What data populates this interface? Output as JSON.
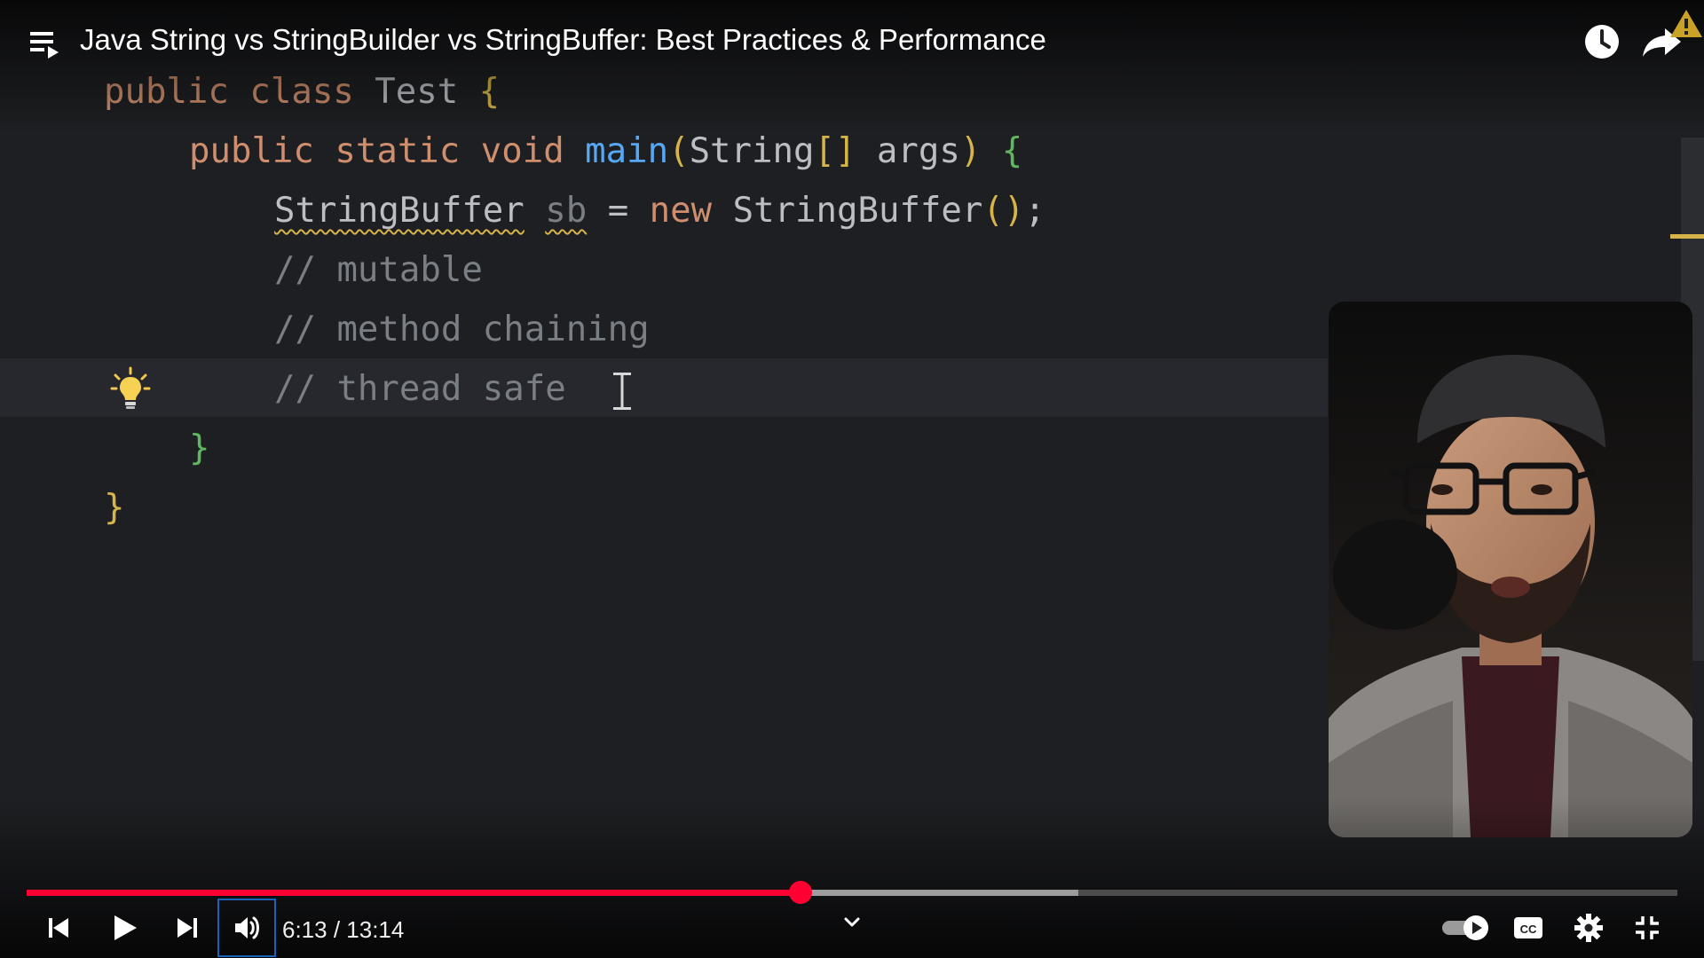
{
  "header": {
    "title": "Java String vs StringBuilder vs StringBuffer: Best Practices & Performance",
    "icons": [
      "playlist-icon",
      "watch-later-icon",
      "share-icon",
      "warning-icon"
    ]
  },
  "editor": {
    "lines": [
      {
        "tokens": [
          "public",
          "class",
          "Test",
          "{"
        ]
      },
      {
        "tokens": [
          "public",
          "static",
          "void",
          "main",
          "(",
          "String",
          "[]",
          "args",
          ")",
          "{"
        ]
      },
      {
        "tokens": [
          "StringBuffer",
          "sb",
          "=",
          "new",
          "StringBuffer",
          "()",
          ";"
        ]
      },
      {
        "tokens": [
          "// mutable"
        ]
      },
      {
        "tokens": [
          "// method chaining"
        ]
      },
      {
        "tokens": [
          "// thread safe"
        ]
      },
      {
        "tokens": [
          "}"
        ]
      },
      {
        "tokens": [
          "}"
        ]
      }
    ],
    "icons": [
      "lightbulb-icon",
      "text-cursor-icon"
    ],
    "colors": {
      "background": "#1e1f22",
      "current_line": "#26282e",
      "keyword": "#cf8e6d",
      "function": "#56a8f5",
      "bracket_yellow": "#d6b44a",
      "bracket_green": "#5fb85f",
      "comment": "#7a7e85",
      "text": "#bcbec4"
    }
  },
  "player": {
    "time": {
      "current": "6:13",
      "separator": " / ",
      "total": "13:14"
    },
    "progress": {
      "played_fraction": 0.469,
      "buffered_fraction": 0.637
    },
    "controls": [
      "previous-icon",
      "play-icon",
      "next-icon",
      "volume-icon",
      "chevron-down-icon",
      "autoplay-toggle-icon",
      "captions-icon",
      "settings-icon",
      "exit-fullscreen-icon"
    ],
    "colors": {
      "progress": "#ff0033",
      "focus_outline": "#1c62b9"
    }
  }
}
